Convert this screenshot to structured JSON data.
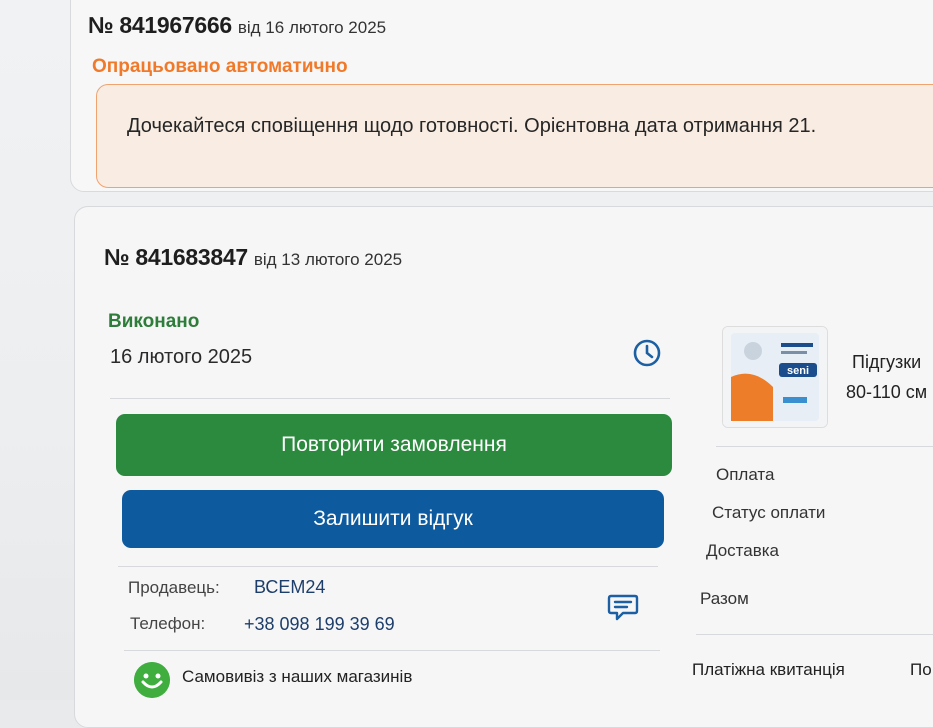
{
  "order1": {
    "number": "№ 841967666",
    "date": "від 16 лютого 2025",
    "status": "Опрацьовано автоматично",
    "notice": "Дочекайтеся сповіщення щодо готовності. Орієнтовна дата отримання 21."
  },
  "order2": {
    "number": "№ 841683847",
    "date": "від 13 лютого 2025",
    "status": "Виконано",
    "completed_date": "16 лютого 2025",
    "repeat_button": "Повторити замовлення",
    "review_button": "Залишити відгук",
    "seller_label": "Продавець:",
    "seller_value": "ВСЕМ24",
    "phone_label": "Телефон:",
    "phone_value": "+38 098 199 39 69",
    "pickup": "Самовивіз з наших магазинів",
    "product": {
      "name": "Підгузки",
      "size": "80-110 см",
      "brand_text": "seni"
    },
    "summary": {
      "payment": "Оплата",
      "payment_status": "Статус оплати",
      "delivery": "Доставка",
      "total": "Разом",
      "receipt": "Платіжна квитанція",
      "receipt_extra": "По"
    }
  },
  "colors": {
    "orange_status": "#f07a2a",
    "green_status": "#2e7d3a",
    "repeat_button": "#2b8a3e",
    "review_button": "#0d5a9e",
    "icon_blue": "#1d5fa3"
  },
  "icons": [
    "clock-icon",
    "chat-icon",
    "pickup-icon"
  ]
}
